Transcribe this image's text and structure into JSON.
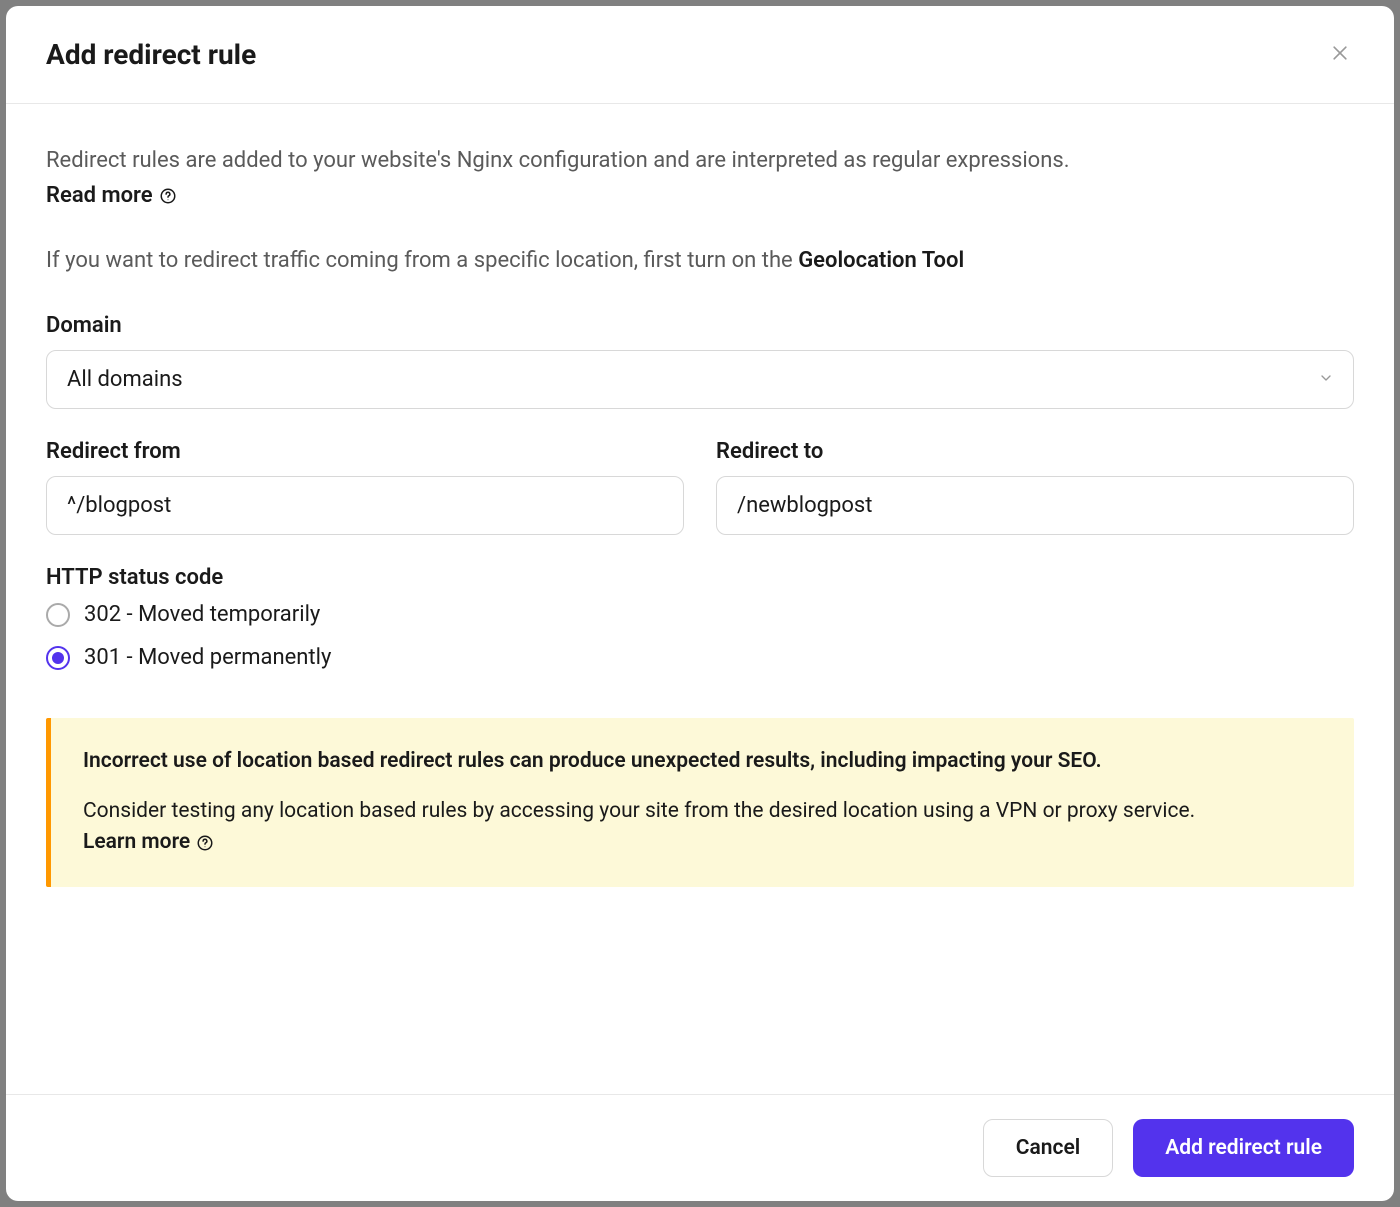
{
  "header": {
    "title": "Add redirect rule"
  },
  "intro": {
    "description": "Redirect rules are added to your website's Nginx configuration and are interpreted as regular expressions.",
    "readMore": "Read more",
    "geoText": "If you want to redirect traffic coming from a specific location, first turn on the ",
    "geoToolLabel": "Geolocation Tool"
  },
  "form": {
    "domain": {
      "label": "Domain",
      "value": "All domains"
    },
    "redirectFrom": {
      "label": "Redirect from",
      "value": "^/blogpost"
    },
    "redirectTo": {
      "label": "Redirect to",
      "value": "/newblogpost"
    },
    "statusCode": {
      "label": "HTTP status code",
      "options": [
        {
          "label": "302 - Moved temporarily",
          "selected": false
        },
        {
          "label": "301 - Moved permanently",
          "selected": true
        }
      ]
    }
  },
  "warning": {
    "line1": "Incorrect use of location based redirect rules can produce unexpected results, including impacting your SEO.",
    "line2a": "Consider testing any location based rules by accessing your site from the desired location using a VPN or proxy service. ",
    "learnMore": "Learn more"
  },
  "footer": {
    "cancel": "Cancel",
    "submit": "Add redirect rule"
  }
}
